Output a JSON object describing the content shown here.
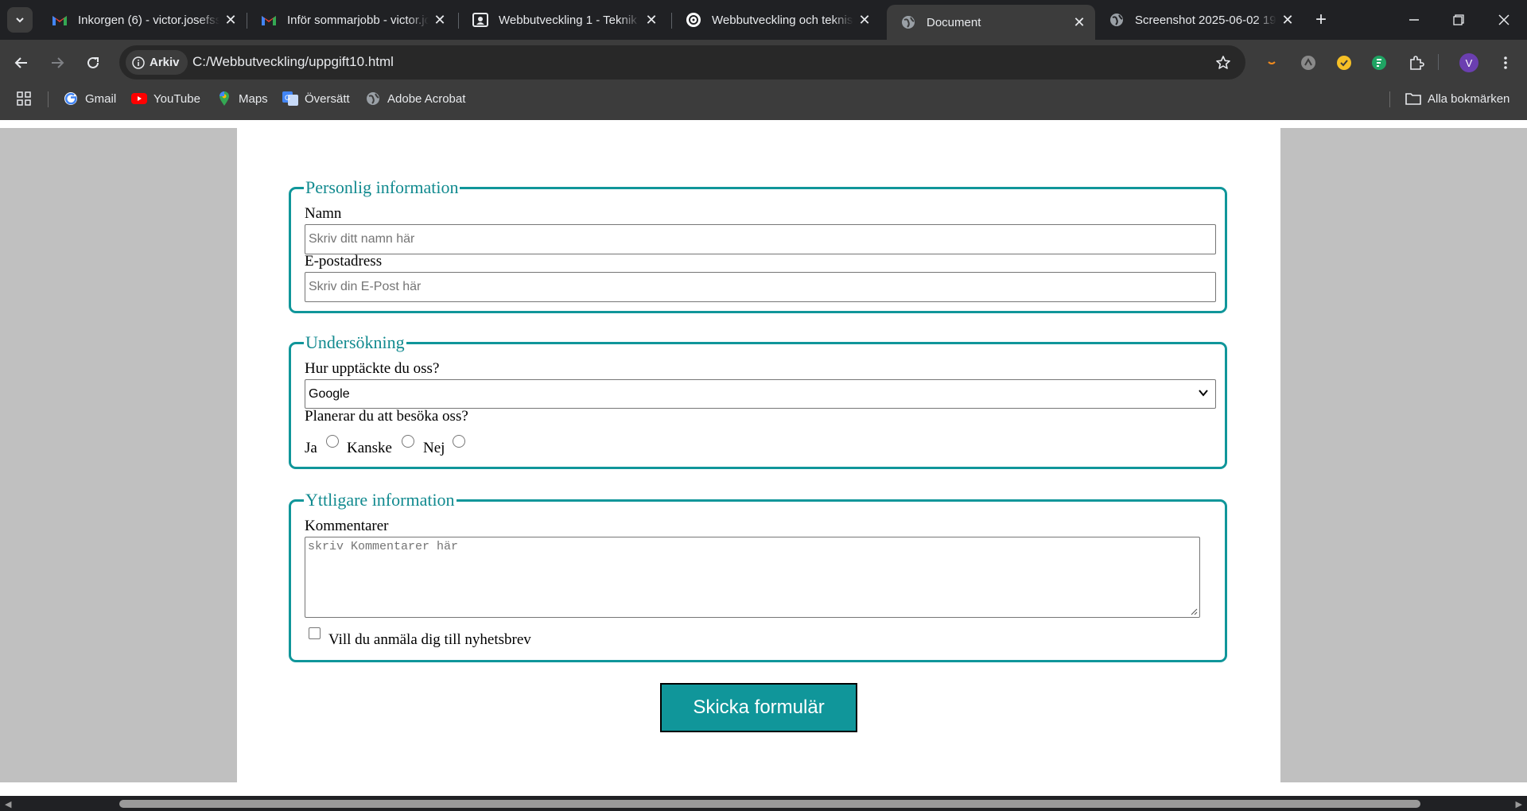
{
  "browser": {
    "tabs": [
      {
        "title": "Inkorgen (6) - victor.josefsson",
        "icon": "gmail-icon",
        "active": false
      },
      {
        "title": "Inför sommarjobb - victor.josefsson",
        "icon": "gmail-icon",
        "active": false
      },
      {
        "title": "Webbutveckling 1 - Teknik",
        "icon": "classroom-icon",
        "active": false
      },
      {
        "title": "Webbutveckling och teknisk",
        "icon": "openai-icon",
        "active": false
      },
      {
        "title": "Document",
        "icon": "globe-icon",
        "active": true
      },
      {
        "title": "Screenshot 2025-06-02 19",
        "icon": "globe-icon",
        "active": false
      }
    ],
    "site_chip": "Arkiv",
    "url": "C:/Webbutveckling/uppgift10.html",
    "profile_initial": "V",
    "bookmarks": [
      "Gmail",
      "YouTube",
      "Maps",
      "Översätt",
      "Adobe Acrobat"
    ],
    "all_bookmarks": "Alla bokmärken"
  },
  "form": {
    "personal": {
      "legend": "Personlig information",
      "name_label": "Namn",
      "name_placeholder": "Skriv ditt namn här",
      "email_label": "E-postadress",
      "email_placeholder": "Skriv din E-Post här"
    },
    "survey": {
      "legend": "Undersökning",
      "source_label": "Hur upptäckte du oss?",
      "source_value": "Google",
      "visit_label": "Planerar du att besöka oss?",
      "options": [
        "Ja",
        "Kanske",
        "Nej"
      ]
    },
    "extra": {
      "legend": "Yttligare information",
      "comments_label": "Kommentarer",
      "comments_placeholder": "skriv Kommentarer här",
      "newsletter_label": "Vill du anmäla dig till nyhetsbrev"
    },
    "submit_label": "Skicka formulär"
  },
  "colors": {
    "accent": "#10969a",
    "gutter": "#c0c0c0"
  }
}
